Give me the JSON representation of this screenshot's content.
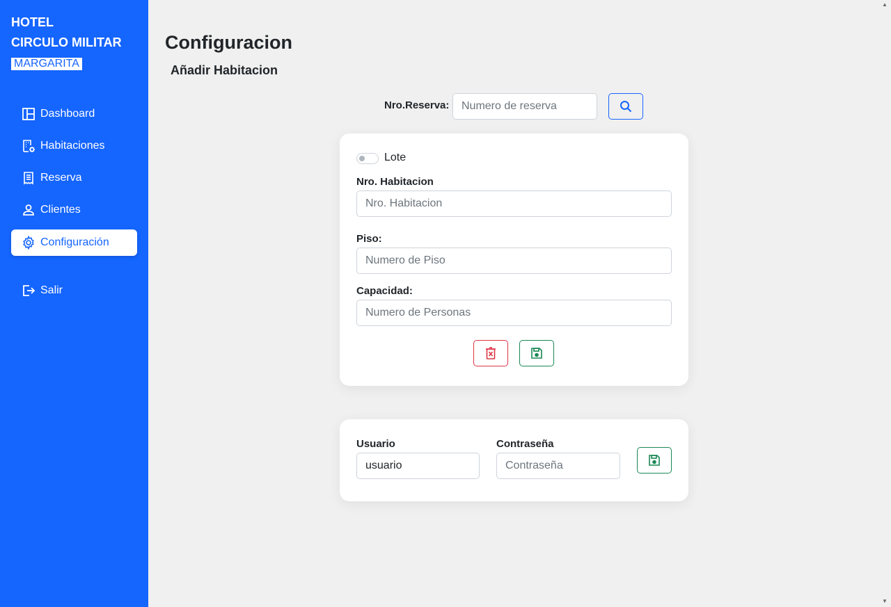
{
  "brand": {
    "line1": "HOTEL",
    "line2": "CIRCULO MILITAR",
    "tag": "MARGARITA"
  },
  "sidebar": {
    "items": [
      {
        "label": "Dashboard",
        "icon": "layout-icon"
      },
      {
        "label": "Habitaciones",
        "icon": "building-gear-icon"
      },
      {
        "label": "Reserva",
        "icon": "receipt-icon"
      },
      {
        "label": "Clientes",
        "icon": "person-icon"
      },
      {
        "label": "Configuración",
        "icon": "gear-icon",
        "active": true
      },
      {
        "label": "Salir",
        "icon": "logout-icon"
      }
    ]
  },
  "header": {
    "title": "Configuracion",
    "subtitle": "Añadir Habitacion"
  },
  "search": {
    "label": "Nro.Reserva:",
    "placeholder": "Numero de reserva"
  },
  "room_form": {
    "toggle_label": "Lote",
    "room_label": "Nro. Habitacion",
    "room_placeholder": "Nro. Habitacion",
    "floor_label": "Piso:",
    "floor_placeholder": "Numero de Piso",
    "capacity_label": "Capacidad:",
    "capacity_placeholder": "Numero de Personas"
  },
  "user_form": {
    "user_label": "Usuario",
    "user_value": "usuario",
    "password_label": "Contraseña",
    "password_placeholder": "Contraseña"
  },
  "colors": {
    "accent": "#1565ff",
    "danger": "#dc3545",
    "success": "#198754"
  }
}
